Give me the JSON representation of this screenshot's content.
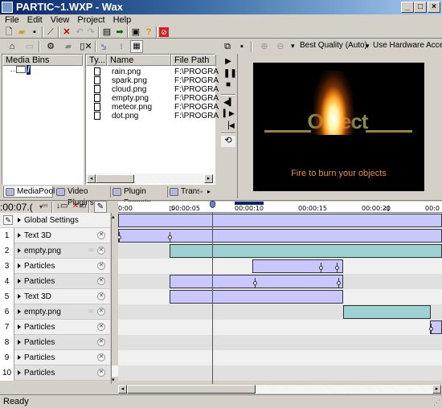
{
  "window": {
    "title": "PARTIC~1.WXP - Wax",
    "minimize": "_",
    "maximize": "□",
    "close": "×"
  },
  "menu": [
    "File",
    "Edit",
    "View",
    "Project",
    "Help"
  ],
  "main_toolbar": {
    "icons": [
      "new-icon",
      "open-icon",
      "save-icon",
      "render-icon",
      "delete-icon",
      "undo-icon",
      "redo-icon",
      "properties-icon",
      "export-arrow-icon",
      "about-icon",
      "help-icon",
      "stop-render-icon"
    ]
  },
  "media_toolbar": {
    "icons": [
      "new-bin-icon",
      "open-bin-icon",
      "plugin-icon",
      "import-icon",
      "remove-media-icon",
      "sort-icon",
      "thumb-view-icon",
      "details-view-icon"
    ]
  },
  "preview_toolbar": {
    "quality": "Best Quality (Auto)",
    "hardware": "Use Hardware Acceler"
  },
  "media_bins": {
    "header": "Media Bins",
    "root": "/"
  },
  "file_list": {
    "columns": [
      "Ty...",
      "Name",
      "File Path"
    ],
    "rows": [
      {
        "name": "rain.png",
        "path": "F:\\PROGRA"
      },
      {
        "name": "spark.png",
        "path": "F:\\PROGRA"
      },
      {
        "name": "cloud.png",
        "path": "F:\\PROGRA"
      },
      {
        "name": "empty.png",
        "path": "F:\\PROGRA"
      },
      {
        "name": "meteor.png",
        "path": "F:\\PROGRA"
      },
      {
        "name": "dot.png",
        "path": "F:\\PROGRA"
      }
    ]
  },
  "tabs": [
    "MediaPool",
    "Video Plugins",
    "Plugin Presets",
    "Trans"
  ],
  "preview": {
    "title_text": "Object",
    "caption": "Fire to burn your objects"
  },
  "transport": [
    "play-icon",
    "pause-icon",
    "stop-icon",
    "prev-frame-icon",
    "next-frame-icon",
    "go-start-icon",
    "loop-icon"
  ],
  "timeline": {
    "timecode": ":00:07.(",
    "ruler": [
      "0:00",
      "00:00:05",
      "00:00:10",
      "00:00:15",
      "00:00:20",
      "00:0"
    ],
    "global_settings": "Global Settings",
    "tracks": [
      {
        "num": "1",
        "name": "Text 3D"
      },
      {
        "num": "2",
        "name": "empty.png"
      },
      {
        "num": "3",
        "name": "Particles"
      },
      {
        "num": "4",
        "name": "Particles"
      },
      {
        "num": "5",
        "name": "Text 3D"
      },
      {
        "num": "6",
        "name": "empty.png"
      },
      {
        "num": "7",
        "name": "Particles"
      },
      {
        "num": "8",
        "name": "Particles"
      },
      {
        "num": "9",
        "name": "Particles"
      },
      {
        "num": "10",
        "name": "Particles"
      }
    ]
  },
  "status": "Ready"
}
